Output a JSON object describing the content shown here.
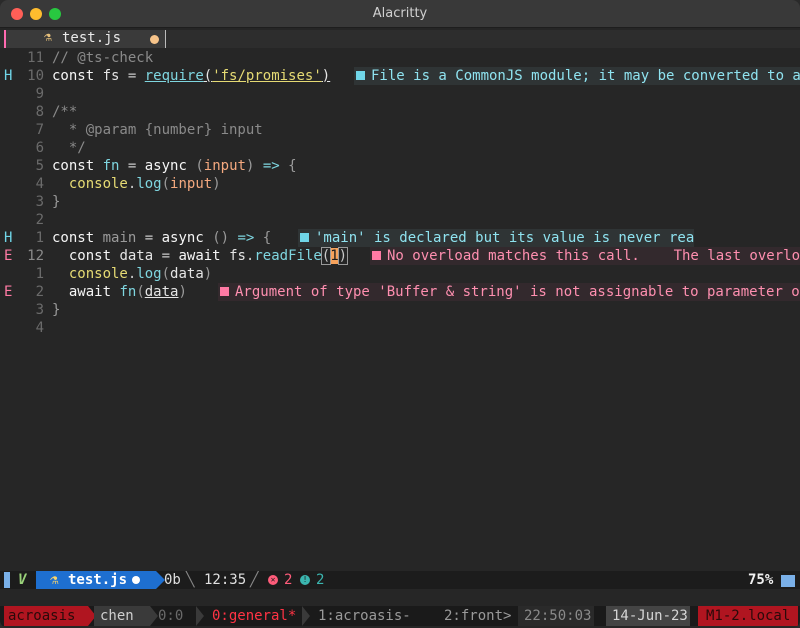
{
  "window": {
    "title": "Alacritty"
  },
  "tabline": {
    "tab_icon": "flask-icon",
    "tab_name": "test.js"
  },
  "editor": {
    "lines": [
      {
        "sign": "",
        "num": "11",
        "diag": null
      },
      {
        "sign": "H",
        "num": "10",
        "diag": {
          "kind": "hint",
          "text": "File is a CommonJS module; it may be converted to an"
        }
      },
      {
        "sign": "",
        "num": "9",
        "diag": null
      },
      {
        "sign": "",
        "num": "8",
        "diag": null
      },
      {
        "sign": "",
        "num": "7",
        "diag": null
      },
      {
        "sign": "",
        "num": "6",
        "diag": null
      },
      {
        "sign": "",
        "num": "5",
        "diag": null
      },
      {
        "sign": "",
        "num": "4",
        "diag": null
      },
      {
        "sign": "",
        "num": "3",
        "diag": null
      },
      {
        "sign": "",
        "num": "2",
        "diag": null
      },
      {
        "sign": "H",
        "num": "1",
        "diag": {
          "kind": "hint",
          "text": "'main' is declared but its value is never read."
        }
      },
      {
        "sign": "E",
        "num": "12",
        "diag": {
          "kind": "err",
          "text": "No overload matches this call.    The last overload"
        }
      },
      {
        "sign": "",
        "num": "1",
        "diag": null
      },
      {
        "sign": "E",
        "num": "2",
        "diag": {
          "kind": "err",
          "text": "Argument of type 'Buffer & string' is not assignable to parameter of t"
        }
      },
      {
        "sign": "",
        "num": "3",
        "diag": null
      },
      {
        "sign": "",
        "num": "4",
        "diag": null
      }
    ]
  },
  "statusline": {
    "mode": "V",
    "file_name": "test.js",
    "size": "0b",
    "position": "12:35",
    "errors": "2",
    "warnings": "2",
    "percent": "75%"
  },
  "tmux": {
    "session": "acroasis",
    "user": "chen",
    "panes": "0:0",
    "active_window": "0:general*",
    "window1": "1:acroasis-",
    "window2": "2:front>",
    "time": "22:50:03",
    "date": "14-Jun-23",
    "host": "M1-2.local"
  }
}
